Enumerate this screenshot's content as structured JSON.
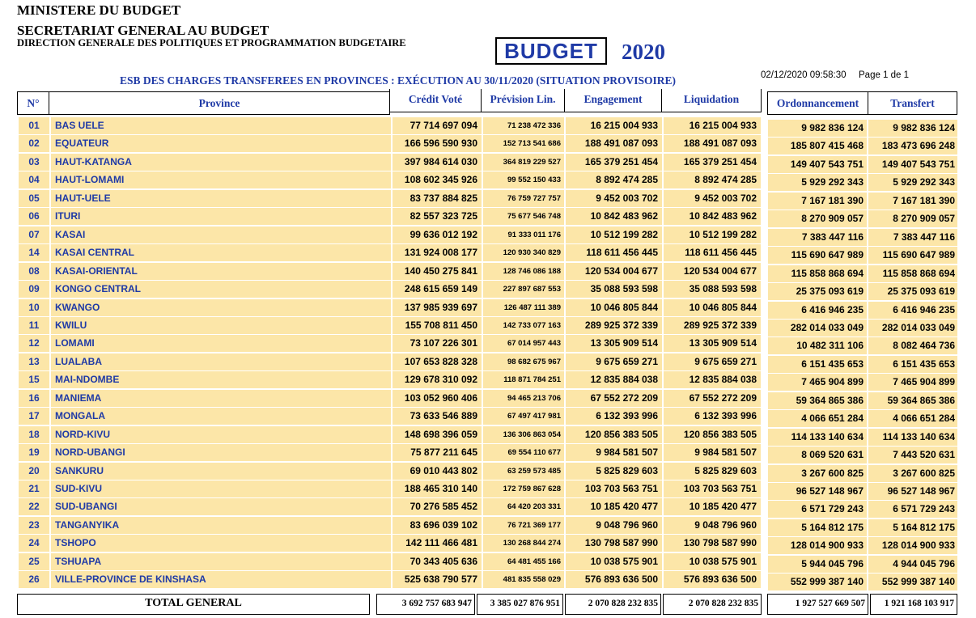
{
  "header": {
    "line1": "MINISTERE DU BUDGET",
    "line2": "SECRETARIAT GENERAL AU BUDGET",
    "line3": "DIRECTION GENERALE DES POLITIQUES ET PROGRAMMATION BUDGETAIRE",
    "budget_label": "BUDGET",
    "year": "2020",
    "subtitle": "ESB  DES CHARGES TRANSFEREES EN PROVINCES : EXÉCUTION AU 30/11/2020 (SITUATION PROVISOIRE)",
    "timestamp": "02/12/2020 09:58:30",
    "page_info": "Page 1 de 1"
  },
  "columns": {
    "num": "N°",
    "province": "Province",
    "credit": "Crédit Voté",
    "prevision": "Prévision Lin.",
    "engagement": "Engagement",
    "liquidation": "Liquidation",
    "ordonnancement": "Ordonnancement",
    "transfert": "Transfert"
  },
  "rows": [
    {
      "num": "01",
      "province": "BAS UELE",
      "credit": "77 714 697 094",
      "prevision": "71 238 472 336",
      "engagement": "16 215 004 933",
      "liquidation": "16 215 004 933",
      "ordonnancement": "9 982 836 124",
      "transfert": "9 982 836 124"
    },
    {
      "num": "02",
      "province": "EQUATEUR",
      "credit": "166 596 590 930",
      "prevision": "152 713 541 686",
      "engagement": "188 491 087 093",
      "liquidation": "188 491 087 093",
      "ordonnancement": "185 807 415 468",
      "transfert": "183 473 696 248"
    },
    {
      "num": "03",
      "province": "HAUT-KATANGA",
      "credit": "397 984 614 030",
      "prevision": "364 819 229 527",
      "engagement": "165 379 251 454",
      "liquidation": "165 379 251 454",
      "ordonnancement": "149 407 543 751",
      "transfert": "149 407 543 751"
    },
    {
      "num": "04",
      "province": "HAUT-LOMAMI",
      "credit": "108 602 345 926",
      "prevision": "99 552 150 433",
      "engagement": "8 892 474 285",
      "liquidation": "8 892 474 285",
      "ordonnancement": "5 929 292 343",
      "transfert": "5 929 292 343"
    },
    {
      "num": "05",
      "province": "HAUT-UELE",
      "credit": "83 737 884 825",
      "prevision": "76 759 727 757",
      "engagement": "9 452 003 702",
      "liquidation": "9 452 003 702",
      "ordonnancement": "7 167 181 390",
      "transfert": "7 167 181 390"
    },
    {
      "num": "06",
      "province": "ITURI",
      "credit": "82 557 323 725",
      "prevision": "75 677 546 748",
      "engagement": "10 842 483 962",
      "liquidation": "10 842 483 962",
      "ordonnancement": "8 270 909 057",
      "transfert": "8 270 909 057"
    },
    {
      "num": "07",
      "province": "KASAI",
      "credit": "99 636 012 192",
      "prevision": "91 333 011 176",
      "engagement": "10 512 199 282",
      "liquidation": "10 512 199 282",
      "ordonnancement": "7 383 447 116",
      "transfert": "7 383 447 116"
    },
    {
      "num": "14",
      "province": "KASAI CENTRAL",
      "credit": "131 924 008 177",
      "prevision": "120 930 340 829",
      "engagement": "118 611 456 445",
      "liquidation": "118 611 456 445",
      "ordonnancement": "115 690 647 989",
      "transfert": "115 690 647 989"
    },
    {
      "num": "08",
      "province": "KASAI-ORIENTAL",
      "credit": "140 450 275 841",
      "prevision": "128 746 086 188",
      "engagement": "120 534 004 677",
      "liquidation": "120 534 004 677",
      "ordonnancement": "115 858 868 694",
      "transfert": "115 858 868 694"
    },
    {
      "num": "09",
      "province": "KONGO CENTRAL",
      "credit": "248 615 659 149",
      "prevision": "227 897 687 553",
      "engagement": "35 088 593 598",
      "liquidation": "35 088 593 598",
      "ordonnancement": "25 375 093 619",
      "transfert": "25 375 093 619"
    },
    {
      "num": "10",
      "province": "KWANGO",
      "credit": "137 985 939 697",
      "prevision": "126 487 111 389",
      "engagement": "10 046 805 844",
      "liquidation": "10 046 805 844",
      "ordonnancement": "6 416 946 235",
      "transfert": "6 416 946 235"
    },
    {
      "num": "11",
      "province": "KWILU",
      "credit": "155 708 811 450",
      "prevision": "142 733 077 163",
      "engagement": "289 925 372 339",
      "liquidation": "289 925 372 339",
      "ordonnancement": "282 014 033 049",
      "transfert": "282 014 033 049"
    },
    {
      "num": "12",
      "province": "LOMAMI",
      "credit": "73 107 226 301",
      "prevision": "67 014 957 443",
      "engagement": "13 305 909 514",
      "liquidation": "13 305 909 514",
      "ordonnancement": "10 482 311 106",
      "transfert": "8 082 464 736"
    },
    {
      "num": "13",
      "province": "LUALABA",
      "credit": "107 653 828 328",
      "prevision": "98 682 675 967",
      "engagement": "9 675 659 271",
      "liquidation": "9 675 659 271",
      "ordonnancement": "6 151 435 653",
      "transfert": "6 151 435 653"
    },
    {
      "num": "15",
      "province": "MAI-NDOMBE",
      "credit": "129 678 310 092",
      "prevision": "118 871 784 251",
      "engagement": "12 835 884 038",
      "liquidation": "12 835 884 038",
      "ordonnancement": "7 465 904 899",
      "transfert": "7 465 904 899"
    },
    {
      "num": "16",
      "province": "MANIEMA",
      "credit": "103 052 960 406",
      "prevision": "94 465 213 706",
      "engagement": "67 552 272 209",
      "liquidation": "67 552 272 209",
      "ordonnancement": "59 364 865 386",
      "transfert": "59 364 865 386"
    },
    {
      "num": "17",
      "province": "MONGALA",
      "credit": "73 633 546 889",
      "prevision": "67 497 417 981",
      "engagement": "6 132 393 996",
      "liquidation": "6 132 393 996",
      "ordonnancement": "4 066 651 284",
      "transfert": "4 066 651 284"
    },
    {
      "num": "18",
      "province": "NORD-KIVU",
      "credit": "148 698 396 059",
      "prevision": "136 306 863 054",
      "engagement": "120 856 383 505",
      "liquidation": "120 856 383 505",
      "ordonnancement": "114 133 140 634",
      "transfert": "114 133 140 634"
    },
    {
      "num": "19",
      "province": "NORD-UBANGI",
      "credit": "75 877 211 645",
      "prevision": "69 554 110 677",
      "engagement": "9 984 581 507",
      "liquidation": "9 984 581 507",
      "ordonnancement": "8 069 520 631",
      "transfert": "7 443 520 631"
    },
    {
      "num": "20",
      "province": "SANKURU",
      "credit": "69 010 443 802",
      "prevision": "63 259 573 485",
      "engagement": "5 825 829 603",
      "liquidation": "5 825 829 603",
      "ordonnancement": "3 267 600 825",
      "transfert": "3 267 600 825"
    },
    {
      "num": "21",
      "province": "SUD-KIVU",
      "credit": "188 465 310 140",
      "prevision": "172 759 867 628",
      "engagement": "103 703 563 751",
      "liquidation": "103 703 563 751",
      "ordonnancement": "96 527 148 967",
      "transfert": "96 527 148 967"
    },
    {
      "num": "22",
      "province": "SUD-UBANGI",
      "credit": "70 276 585 452",
      "prevision": "64 420 203 331",
      "engagement": "10 185 420 477",
      "liquidation": "10 185 420 477",
      "ordonnancement": "6 571 729 243",
      "transfert": "6 571 729 243"
    },
    {
      "num": "23",
      "province": "TANGANYIKA",
      "credit": "83 696 039 102",
      "prevision": "76 721 369 177",
      "engagement": "9 048 796 960",
      "liquidation": "9 048 796 960",
      "ordonnancement": "5 164 812 175",
      "transfert": "5 164 812 175"
    },
    {
      "num": "24",
      "province": "TSHOPO",
      "credit": "142 111 466 481",
      "prevision": "130 268 844 274",
      "engagement": "130 798 587 990",
      "liquidation": "130 798 587 990",
      "ordonnancement": "128 014 900 933",
      "transfert": "128 014 900 933"
    },
    {
      "num": "25",
      "province": "TSHUAPA",
      "credit": "70 343 405 636",
      "prevision": "64 481 455 166",
      "engagement": "10 038 575 901",
      "liquidation": "10 038 575 901",
      "ordonnancement": "5 944 045 796",
      "transfert": "4 944 045 796"
    },
    {
      "num": "26",
      "province": "VILLE-PROVINCE DE KINSHASA",
      "credit": "525 638 790 577",
      "prevision": "481 835 558 029",
      "engagement": "576 893 636 500",
      "liquidation": "576 893 636 500",
      "ordonnancement": "552 999 387 140",
      "transfert": "552 999 387 140"
    }
  ],
  "totals": {
    "label": "TOTAL GENERAL",
    "credit": "3 692 757 683 947",
    "prevision": "3 385 027 876 951",
    "engagement": "2 070 828 232 835",
    "liquidation": "2 070 828 232 835",
    "ordonnancement": "1 927 527 669 507",
    "transfert": "1 921 168 103 917"
  },
  "colors": {
    "accent_blue": "#1f3aa6",
    "row_fill": "#fce6a8"
  }
}
